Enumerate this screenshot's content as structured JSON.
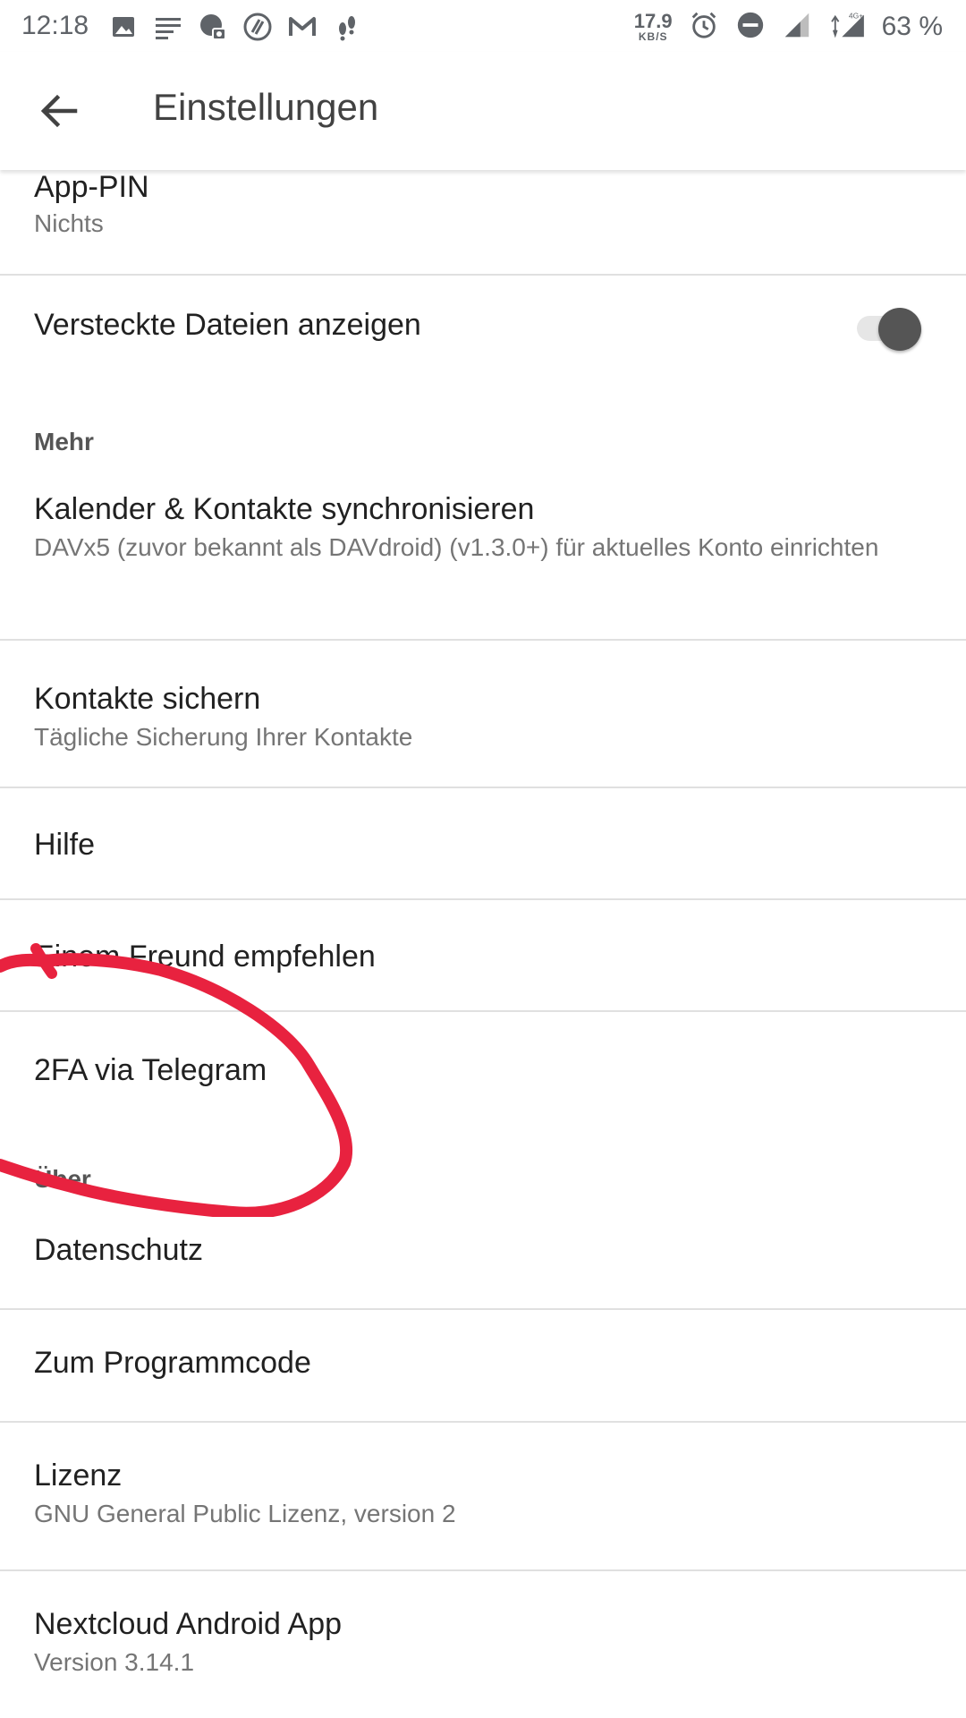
{
  "status_bar": {
    "time": "12:18",
    "speed_value": "17.9",
    "speed_unit": "KB/S",
    "battery": "63 %",
    "network": "4G+",
    "icons": [
      "image-icon",
      "notes-icon",
      "cloud-camera-icon",
      "at-icon",
      "gmail-icon",
      "footsteps-icon",
      "alarm-icon",
      "dnd-icon",
      "signal-icon",
      "signal-4g-icon"
    ]
  },
  "app_bar": {
    "title": "Einstellungen",
    "back_icon": "back-arrow-icon"
  },
  "settings": {
    "app_pin": {
      "title": "App-PIN",
      "summary": "Nichts"
    },
    "hidden_files": {
      "title": "Versteckte Dateien anzeigen",
      "toggle_on": true
    },
    "section_more": "Mehr",
    "sync": {
      "title": "Kalender & Kontakte synchronisieren",
      "summary": "DAVx5 (zuvor bekannt als DAVdroid) (v1.3.0+) für aktuelles Konto einrichten"
    },
    "backup_contacts": {
      "title": "Kontakte sichern",
      "summary": "Tägliche Sicherung Ihrer Kontakte"
    },
    "help": {
      "title": "Hilfe"
    },
    "recommend": {
      "title": "Einem Freund empfehlen"
    },
    "twofa": {
      "title": "2FA via Telegram"
    },
    "section_about": "Über",
    "privacy": {
      "title": "Datenschutz"
    },
    "source_code": {
      "title": "Zum Programmcode"
    },
    "license": {
      "title": "Lizenz",
      "summary": "GNU General Public Lizenz, version 2"
    },
    "app_info": {
      "title": "Nextcloud Android App",
      "summary": "Version 3.14.1"
    }
  },
  "colors": {
    "annotation": "#e8223f",
    "toggle_thumb": "#555555",
    "divider": "#e0e0e0"
  }
}
